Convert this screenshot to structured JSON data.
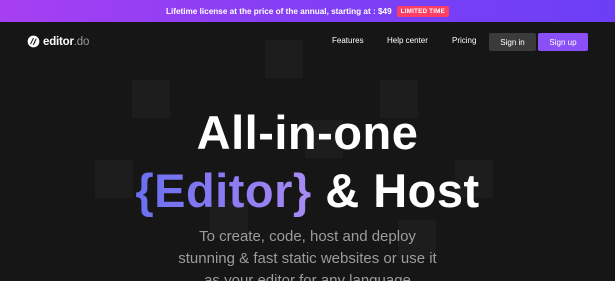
{
  "banner": {
    "text": "Lifetime license at the price of the annual, starting at : $49",
    "badge": "LIMITED TIME"
  },
  "nav": {
    "logo_name": "editor",
    "logo_suffix": ".do",
    "links": [
      "Features",
      "Help center",
      "Pricing"
    ],
    "sign_in": "Sign in",
    "sign_up": "Sign up"
  },
  "hero": {
    "line1": "All-in-one",
    "accent": "{Editor}",
    "line2_rest": " & Host",
    "subtitle_lines": [
      "To create, code, host and deploy",
      "stunning & fast static websites or use it",
      "as your editor for any language"
    ]
  },
  "colors": {
    "banner_start": "#a73ff2",
    "banner_end": "#6b3ff6",
    "badge": "#ff3e66",
    "accent": "#8a4ff7",
    "background": "#161616"
  },
  "icons": {
    "logo": "editor-logo-icon"
  }
}
